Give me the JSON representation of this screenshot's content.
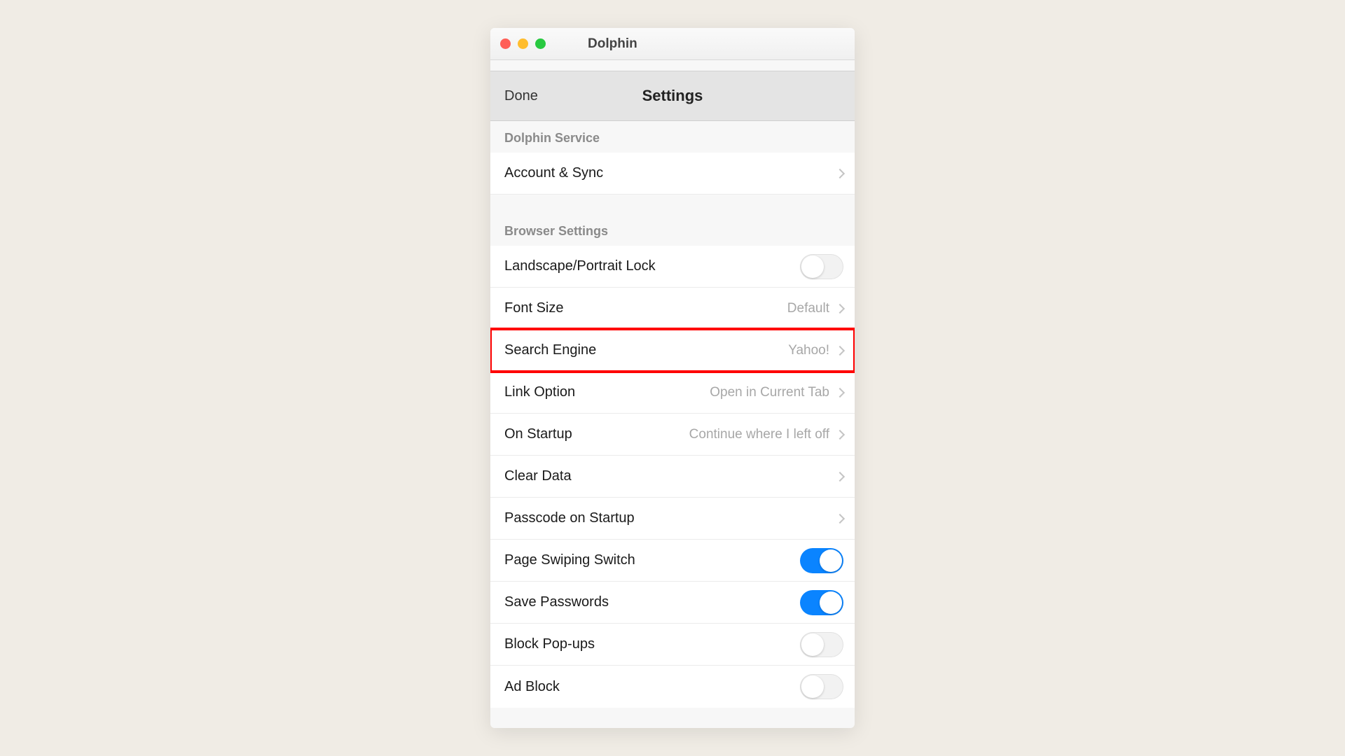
{
  "titlebar": {
    "app_name": "Dolphin"
  },
  "navbar": {
    "done": "Done",
    "title": "Settings"
  },
  "sections": {
    "service": {
      "header": "Dolphin Service"
    },
    "browser": {
      "header": "Browser Settings"
    }
  },
  "rows": {
    "account_sync": {
      "label": "Account & Sync"
    },
    "landscape_lock": {
      "label": "Landscape/Portrait Lock",
      "on": false
    },
    "font_size": {
      "label": "Font Size",
      "value": "Default"
    },
    "search_engine": {
      "label": "Search Engine",
      "value": "Yahoo!"
    },
    "link_option": {
      "label": "Link Option",
      "value": "Open in Current Tab"
    },
    "on_startup": {
      "label": "On Startup",
      "value": "Continue where I left off"
    },
    "clear_data": {
      "label": "Clear Data"
    },
    "passcode_startup": {
      "label": "Passcode on Startup"
    },
    "page_swiping": {
      "label": "Page Swiping Switch",
      "on": true
    },
    "save_passwords": {
      "label": "Save Passwords",
      "on": true
    },
    "block_popups": {
      "label": "Block Pop-ups",
      "on": false
    },
    "ad_block": {
      "label": "Ad Block",
      "on": false
    }
  },
  "highlight_row": "search_engine"
}
